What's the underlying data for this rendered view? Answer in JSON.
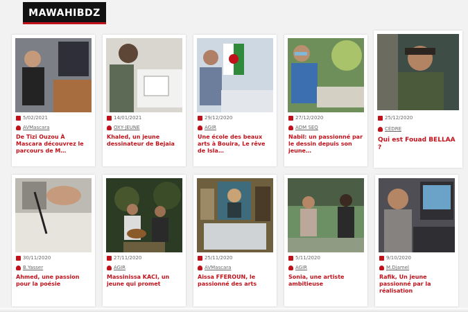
{
  "brand": {
    "logo_text": "MAWAHIBDZ"
  },
  "cards": [
    {
      "date": "5/02/2021",
      "author": "AVMascara",
      "title": "De Tizi Ouzou À Mascara découvrez le parcours de M…",
      "colors": [
        "#7d7f87",
        "#2f2f3a",
        "#a86d3e"
      ]
    },
    {
      "date": "14/01/2021",
      "author": "OXY-JEUNE",
      "title": "Khaled, un jeune dessinateur de Bejaia",
      "colors": [
        "#d8d6cf",
        "#5d6a55",
        "#f2f2f0"
      ]
    },
    {
      "date": "29/12/2020",
      "author": "AGIR",
      "title": "Une école des beaux arts à Bouira, Le rêve de Isla…",
      "colors": [
        "#cdd8e2",
        "#9db4c6",
        "#d5dbe2"
      ]
    },
    {
      "date": "27/12/2020",
      "author": "ADM SEQ",
      "title": "Nabil: un passionné par le dessin depuis son jeune…",
      "colors": [
        "#6e8e5a",
        "#a9c36a",
        "#3f5c2d"
      ]
    },
    {
      "date": "25/12/2020",
      "author": "CÈDRE",
      "title": "Qui est Fouad BELLAA ?",
      "colors": [
        "#3e4d46",
        "#6c6b5f",
        "#2d3530"
      ]
    },
    {
      "date": "30/11/2020",
      "author": "B.Yasser",
      "title": "Ahmed, une passion pour la poésie",
      "colors": [
        "#bdbab4",
        "#8a8680",
        "#e7e3dd"
      ]
    },
    {
      "date": "27/11/2020",
      "author": "AGIR",
      "title": "Massinissa KACI, un jeune qui promet",
      "colors": [
        "#2b3b24",
        "#48562e",
        "#6b5e3f"
      ]
    },
    {
      "date": "25/11/2020",
      "author": "AVMascara",
      "title": "Aissa FFEROUN, le passionné des arts",
      "colors": [
        "#6e5f3f",
        "#3f6c7c",
        "#9b8a65"
      ]
    },
    {
      "date": "5/11/2020",
      "author": "AGIR",
      "title": "Sonia, une artiste ambitieuse",
      "colors": [
        "#6d8f64",
        "#bba89a",
        "#4b5d45"
      ]
    },
    {
      "date": "9/10/2020",
      "author": "M.Djamel",
      "title": "Rafik, Un jeune passionné par la réalisation",
      "colors": [
        "#4e4e54",
        "#86827f",
        "#2e2e33"
      ]
    }
  ]
}
